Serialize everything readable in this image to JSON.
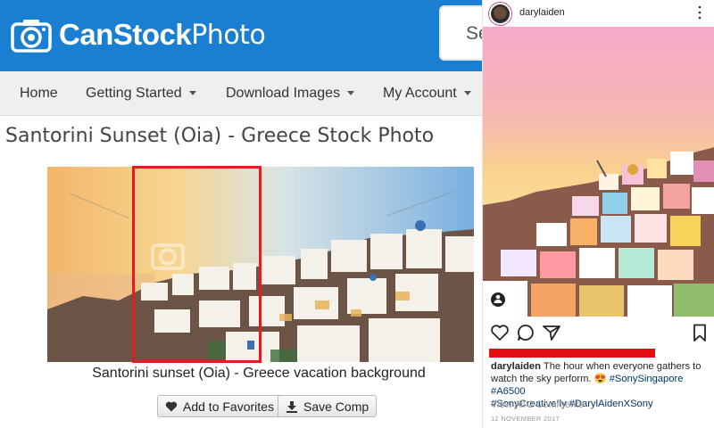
{
  "canstock": {
    "logo": {
      "bold": "CanStock",
      "light": "Photo"
    },
    "search_placeholder": "Se",
    "nav": [
      {
        "label": "Home",
        "dropdown": false
      },
      {
        "label": "Getting Started",
        "dropdown": true
      },
      {
        "label": "Download Images",
        "dropdown": true
      },
      {
        "label": "My Account",
        "dropdown": true
      }
    ],
    "page_title": "Santorini Sunset (Oia) - Greece Stock Photo",
    "photo_caption": "Santorini sunset (Oia) - Greece vacation background",
    "buttons": {
      "favorites": "Add to Favorites",
      "save_comp": "Save Comp"
    },
    "colors": {
      "header": "#1a7fd0",
      "highlight": "#e31c23"
    }
  },
  "instagram": {
    "username": "darylaiden",
    "caption_user": "darylaiden",
    "caption_text": "The hour when everyone gathers to watch the sky perform. 😍",
    "hashtags_line1": "#SonySingapore #A6500",
    "hashtags_line2": "#SonyCreativeIly #DarylAidenXSony",
    "view_comments": "View All 2 Comments",
    "date": "12 NOVEMBER 2017",
    "icons": [
      "heart-icon",
      "comment-icon",
      "share-icon",
      "bookmark-icon"
    ],
    "colors": {
      "redaction": "#e20e13",
      "hashtag": "#003569"
    }
  }
}
